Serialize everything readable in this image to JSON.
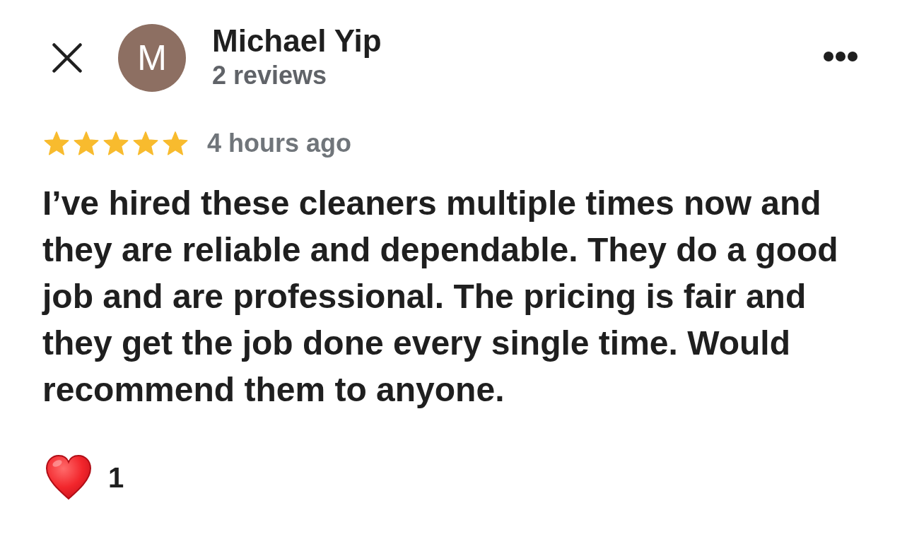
{
  "header": {
    "avatar_initial": "M",
    "name": "Michael Yip",
    "review_count": "2 reviews"
  },
  "review": {
    "stars": 5,
    "time": "4 hours ago",
    "text": "I’ve hired these cleaners multiple times now and they are reliable and dependable. They do a good job and are professional. The pricing is fair and they get the job done every single time. Would recommend them to anyone."
  },
  "reaction": {
    "count": "1"
  }
}
